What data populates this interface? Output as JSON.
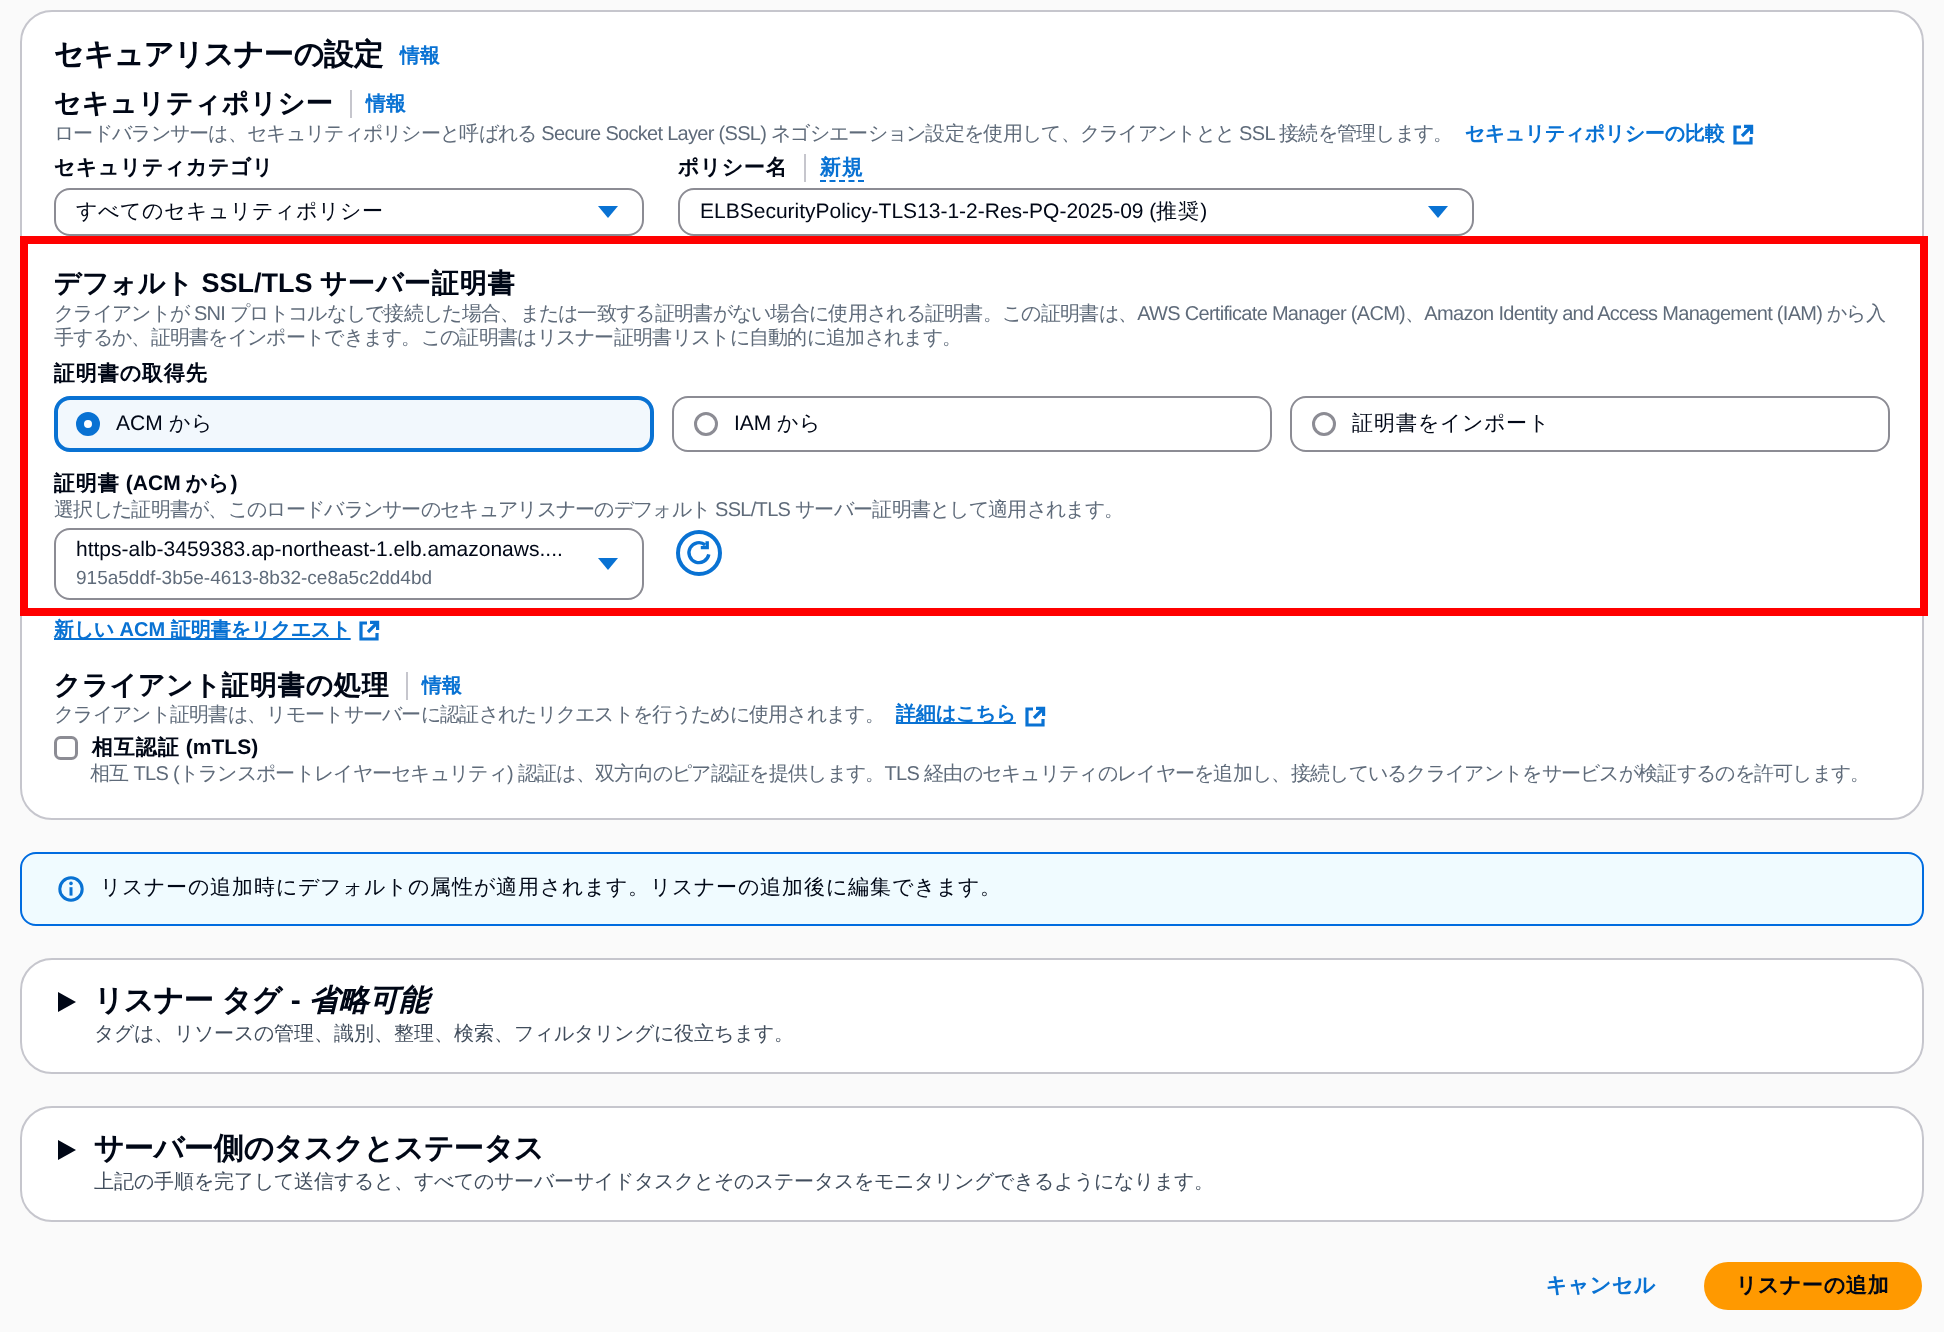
{
  "secure_listener": {
    "title": "セキュアリスナーの設定",
    "info_link": "情報",
    "security_policy": {
      "title": "セキュリティポリシー",
      "info_link": "情報",
      "description": "ロードバランサーは、セキュリティポリシーと呼ばれる Secure Socket Layer (SSL) ネゴシエーション設定を使用して、クライアントとと SSL 接続を管理します。",
      "description_link": "セキュリティポリシーの比較",
      "category": {
        "label": "セキュリティカテゴリ",
        "value": "すべてのセキュリティポリシー"
      },
      "policy": {
        "label": "ポリシー名",
        "new_link": "新規",
        "value": "ELBSecurityPolicy-TLS13-1-2-Res-PQ-2025-09 (推奨)"
      }
    },
    "default_certificate": {
      "highlighted": true,
      "title": "デフォルト SSL/TLS サーバー証明書",
      "description": "クライアントが SNI プロトコルなしで接続した場合、または一致する証明書がない場合に使用される証明書。この証明書は、AWS Certificate Manager (ACM)、Amazon Identity and Access Management (IAM) から入手するか、証明書をインポートできます。この証明書はリスナー証明書リストに自動的に追加されます。",
      "source_label": "証明書の取得先",
      "sources": [
        {
          "label": "ACM から",
          "selected": true
        },
        {
          "label": "IAM から",
          "selected": false
        },
        {
          "label": "証明書をインポート",
          "selected": false
        }
      ],
      "certificate": {
        "label": "証明書 (ACM から)",
        "description": "選択した証明書が、このロードバランサーのセキュアリスナーのデフォルト SSL/TLS サーバー証明書として適用されます。",
        "value": "https-alb-3459383.ap-northeast-1.elb.amazonaws....",
        "secondary": "915a5ddf-3b5e-4613-8b32-ce8a5c2dd4bd"
      },
      "request_link": "新しい ACM 証明書をリクエスト"
    },
    "client_certificate": {
      "title": "クライアント証明書の処理",
      "info_link": "情報",
      "description": "クライアント証明書は、リモートサーバーに認証されたリクエストを行うために使用されます。",
      "description_link": "詳細はこちら",
      "mtls": {
        "label": "相互認証 (mTLS)",
        "checked": false,
        "description": "相互 TLS (トランスポートレイヤーセキュリティ) 認証は、双方向のピア認証を提供します。TLS 経由のセキュリティのレイヤーを追加し、接続しているクライアントをサービスが検証するのを許可します。"
      }
    }
  },
  "info_alert": {
    "text": "リスナーの追加時にデフォルトの属性が適用されます。リスナーの追加後に編集できます。"
  },
  "sections": [
    {
      "title": "リスナー タグ - *省略可能*",
      "expanded": false,
      "description": "タグは、リソースの管理、識別、整理、検索、フィルタリングに役立ちます。"
    },
    {
      "title": "サーバー側のタスクとステータス",
      "expanded": false,
      "description": "上記の手順を完了して送信すると、すべてのサーバーサイドタスクとそのステータスをモニタリングできるようになります。"
    }
  ],
  "footer": {
    "buttons": [
      {
        "label": "キャンセル",
        "kind": "link"
      },
      {
        "label": "リスナーの追加",
        "kind": "primary"
      }
    ]
  }
}
